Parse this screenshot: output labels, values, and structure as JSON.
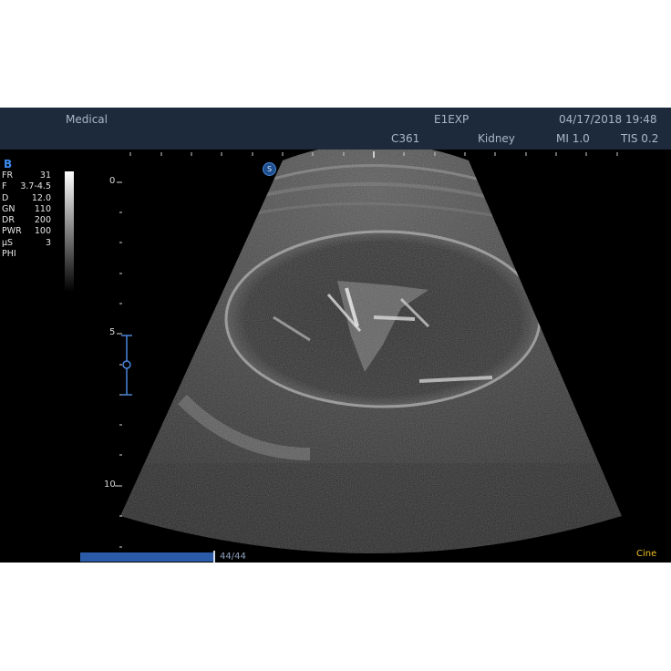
{
  "header": {
    "app_name": "Medical",
    "exam_type": "E1EXP",
    "datetime": "04/17/2018 19:48",
    "probe": "C361",
    "preset": "Kidney",
    "mi": "MI 1.0",
    "tis": "TIS 0.2"
  },
  "mode": "B",
  "parameters": [
    {
      "key": "FR",
      "value": "31"
    },
    {
      "key": "F",
      "value": "3.7-4.5"
    },
    {
      "key": "D",
      "value": "12.0"
    },
    {
      "key": "GN",
      "value": "110"
    },
    {
      "key": "DR",
      "value": "200"
    },
    {
      "key": "PWR",
      "value": "100"
    },
    {
      "key": "µS",
      "value": "3"
    },
    {
      "key": "PHI",
      "value": ""
    }
  ],
  "depth_scale": {
    "label_0": "0",
    "label_5": "5",
    "label_10": "10"
  },
  "orientation_marker": "S",
  "cine": {
    "frame_count": "44/44",
    "label": "Cine",
    "progress": 1.0
  },
  "colors": {
    "topbar": "#1c2a3c",
    "header_text": "#a9b7c8",
    "mode_label": "#3d8cf0",
    "cine_bar": "#2a5aa8",
    "cine_label": "#f0c020"
  }
}
